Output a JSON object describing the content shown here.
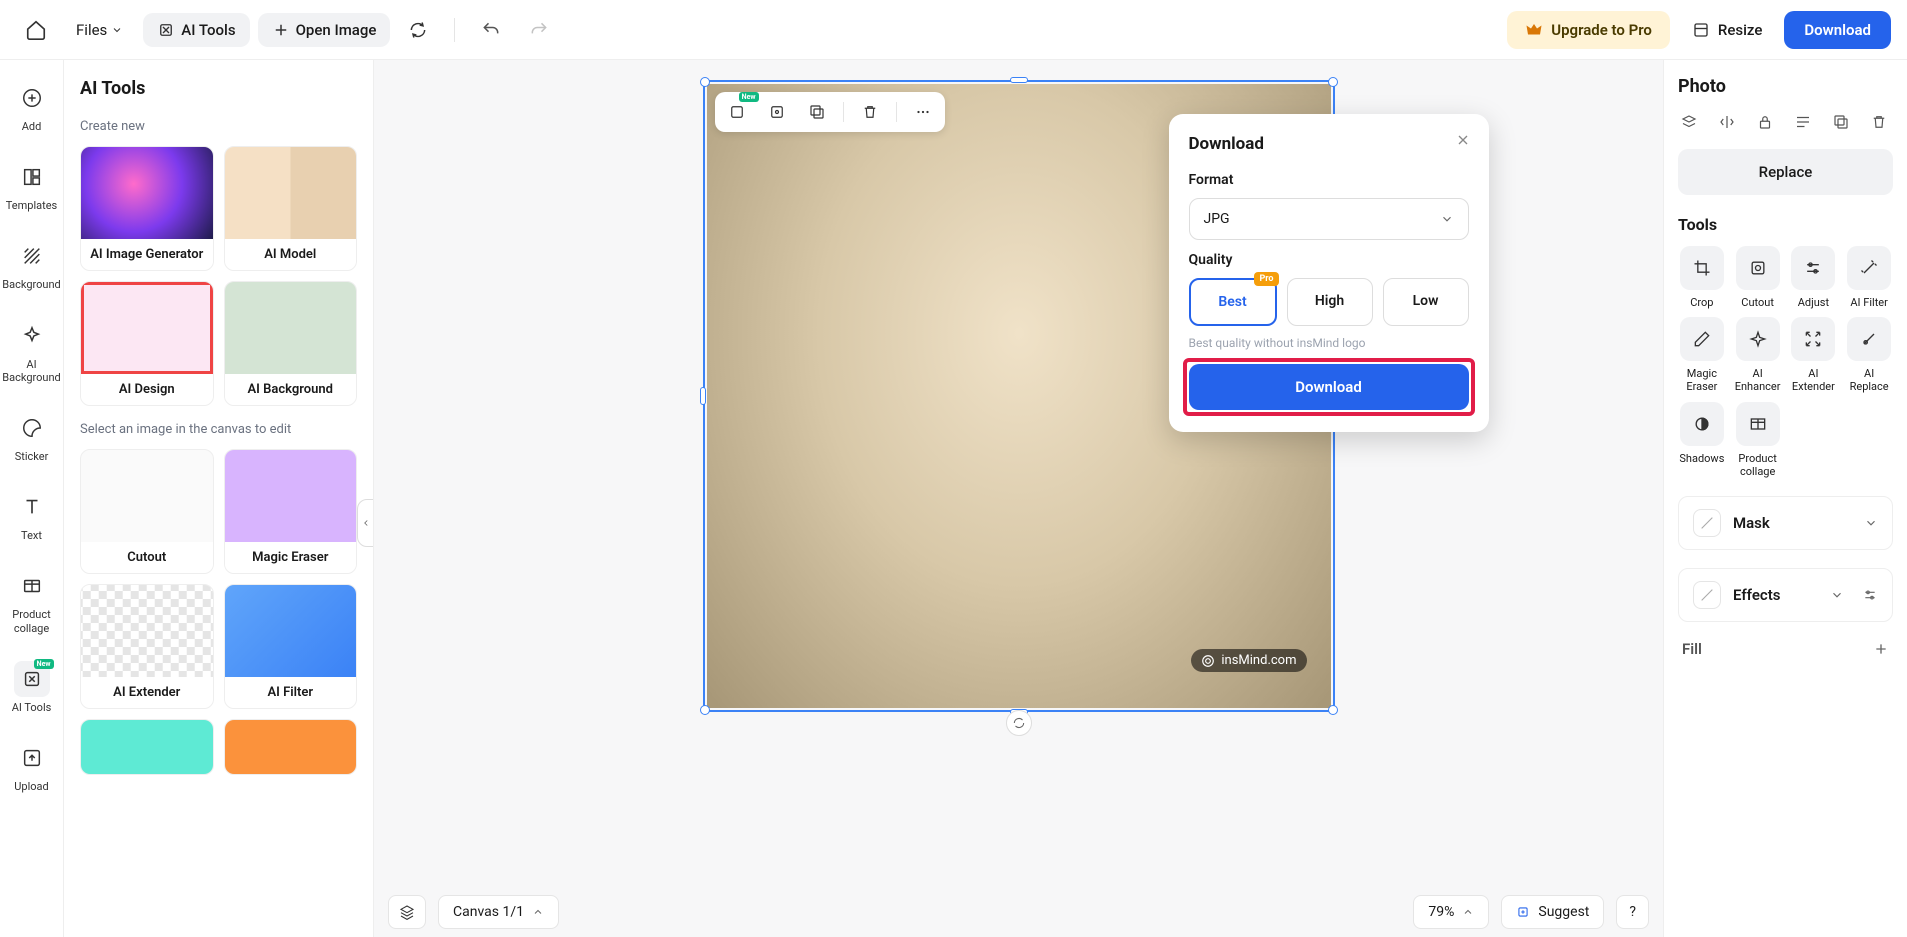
{
  "topbar": {
    "files": "Files",
    "ai_tools": "AI Tools",
    "open_image": "Open Image",
    "upgrade": "Upgrade to Pro",
    "resize": "Resize",
    "download": "Download"
  },
  "rail": {
    "add": "Add",
    "templates": "Templates",
    "background": "Background",
    "ai_background": "AI Background",
    "sticker": "Sticker",
    "text": "Text",
    "product_collage": "Product collage",
    "ai_tools": "AI Tools",
    "upload": "Upload",
    "new_badge": "New"
  },
  "left_panel": {
    "title": "AI Tools",
    "create_new": "Create new",
    "select_hint": "Select an image in the canvas to edit",
    "cards": {
      "ai_image_generator": "AI Image Generator",
      "ai_model": "AI Model",
      "ai_design": "AI Design",
      "ai_background": "AI Background",
      "cutout": "Cutout",
      "magic_eraser": "Magic Eraser",
      "ai_extender": "AI Extender",
      "ai_filter": "AI Filter"
    }
  },
  "canvas": {
    "watermark": "insMind.com",
    "ctx_new": "New"
  },
  "download_modal": {
    "title": "Download",
    "format_label": "Format",
    "format_value": "JPG",
    "quality_label": "Quality",
    "q_best": "Best",
    "q_high": "High",
    "q_low": "Low",
    "pro": "Pro",
    "hint": "Best quality without insMind logo",
    "button": "Download"
  },
  "statusbar": {
    "canvas": "Canvas 1/1",
    "zoom": "79%",
    "suggest": "Suggest",
    "help": "?"
  },
  "right_panel": {
    "title": "Photo",
    "replace": "Replace",
    "tools_title": "Tools",
    "tools": {
      "crop": "Crop",
      "cutout": "Cutout",
      "adjust": "Adjust",
      "ai_filter": "AI Filter",
      "magic_eraser": "Magic Eraser",
      "ai_enhancer": "AI Enhancer",
      "ai_extender": "AI Extender",
      "ai_replace": "AI Replace",
      "shadows": "Shadows",
      "product_collage": "Product collage"
    },
    "mask": "Mask",
    "effects": "Effects",
    "fill": "Fill"
  }
}
